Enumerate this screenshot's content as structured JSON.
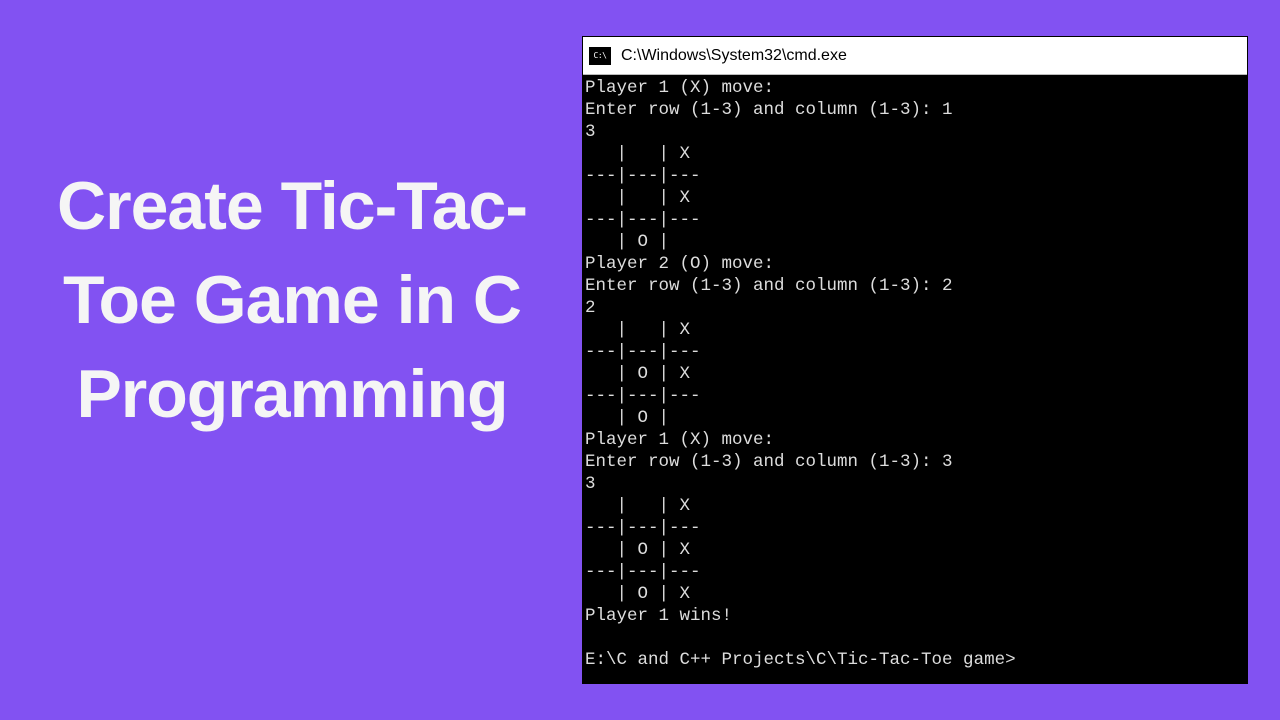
{
  "heading": "Create Tic-Tac-Toe Game in C Programming",
  "window": {
    "title": "C:\\Windows\\System32\\cmd.exe"
  },
  "terminal_lines": [
    "Player 1 (X) move:",
    "Enter row (1-3) and column (1-3): 1",
    "3",
    "   |   | X",
    "---|---|---",
    "   |   | X",
    "---|---|---",
    "   | O |",
    "Player 2 (O) move:",
    "Enter row (1-3) and column (1-3): 2",
    "2",
    "   |   | X",
    "---|---|---",
    "   | O | X",
    "---|---|---",
    "   | O |",
    "Player 1 (X) move:",
    "Enter row (1-3) and column (1-3): 3",
    "3",
    "   |   | X",
    "---|---|---",
    "   | O | X",
    "---|---|---",
    "   | O | X",
    "Player 1 wins!",
    "",
    "E:\\C and C++ Projects\\C\\Tic-Tac-Toe game>"
  ]
}
